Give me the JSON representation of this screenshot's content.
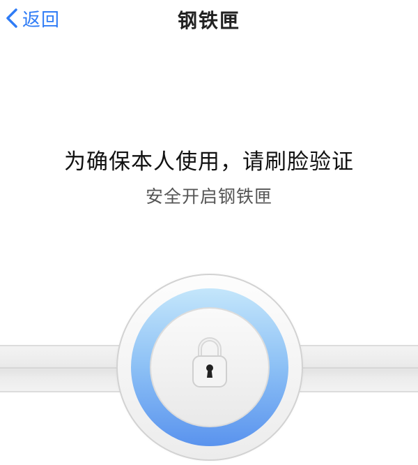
{
  "nav": {
    "back_label": "返回",
    "back_icon": "chevron-left-icon",
    "title": "钢铁匣"
  },
  "prompt": {
    "title": "为确保本人使用，请刷脸验证",
    "subtitle": "安全开启钢铁匣"
  },
  "lock": {
    "icon": "keyhole-lock-icon"
  },
  "colors": {
    "accent": "#2f7cf6",
    "ring_top": "#c4e6fb",
    "ring_bottom": "#5a93ee"
  }
}
